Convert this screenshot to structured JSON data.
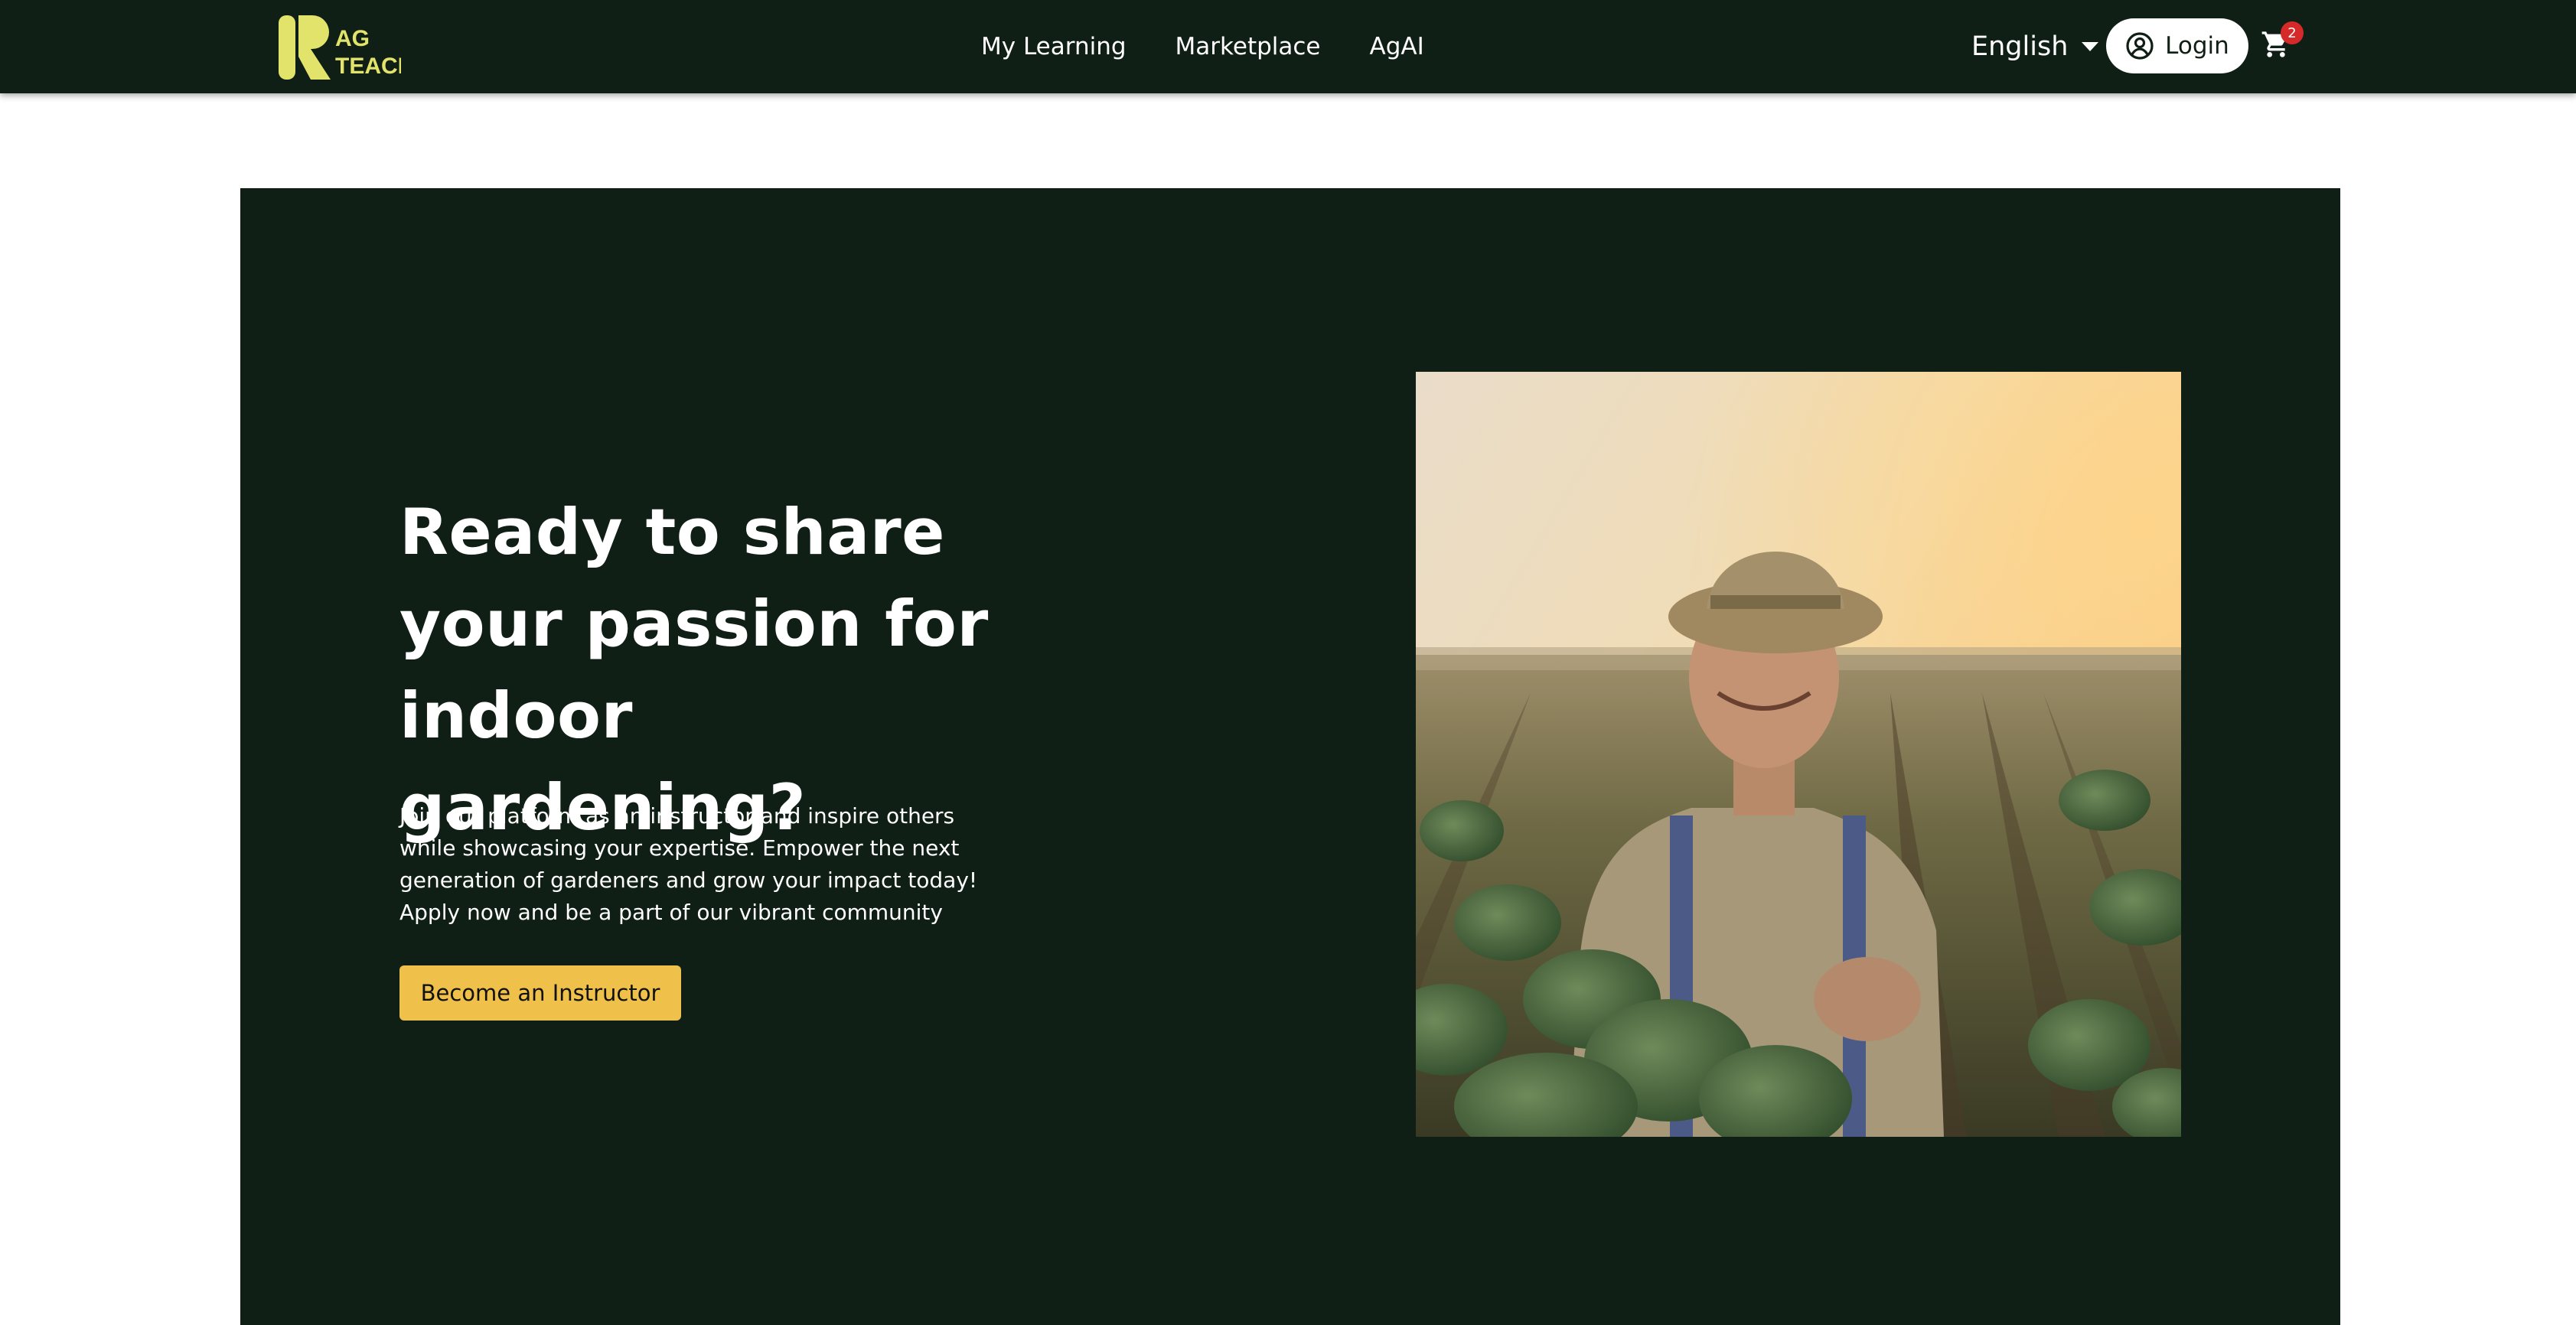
{
  "header": {
    "logo": {
      "text_line1": "AG",
      "text_line2": "TEACH",
      "brand_color": "#e2e36a"
    },
    "nav": [
      {
        "label": "My Learning"
      },
      {
        "label": "Marketplace"
      },
      {
        "label": "AgAI"
      }
    ],
    "language": {
      "selected": "English",
      "icon": "chevron-down-icon"
    },
    "login": {
      "label": "Login",
      "icon": "user-circle-icon"
    },
    "cart": {
      "icon": "cart-icon",
      "count": "2"
    }
  },
  "hero": {
    "title": "Ready to share your passion for indoor gardening?",
    "description": "Join our platform as an instructor and inspire others while showcasing your expertise. Empower the next generation of gardeners and grow your impact today! Apply now and be a part of our vibrant community",
    "cta_label": "Become an Instructor",
    "image": "farmer-in-field-photo"
  },
  "colors": {
    "background_dark": "#0f1f15",
    "cta": "#efc14a",
    "badge": "#d62a2a",
    "page_background": "#ffffff"
  }
}
